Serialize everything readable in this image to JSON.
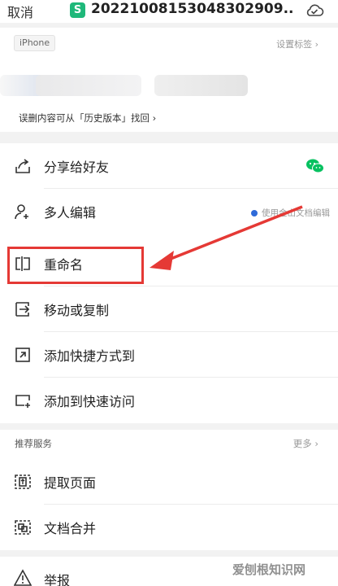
{
  "header": {
    "cancel_label": "取消",
    "file_badge": "S",
    "file_title": "20221008153048302909..."
  },
  "info": {
    "device_tag": "iPhone",
    "set_tag_label": "设置标签",
    "history_link": "误删内容可从「历史版本」找回"
  },
  "menu": {
    "share": "分享给好友",
    "multi_edit": "多人编辑",
    "multi_edit_hint": "使用金山文档编辑",
    "rename": "重命名",
    "move_copy": "移动或复制",
    "add_shortcut": "添加快捷方式到",
    "add_quick_access": "添加到快速访问"
  },
  "services": {
    "title": "推荐服务",
    "more_label": "更多",
    "extract_pages": "提取页面",
    "merge_docs": "文档合并"
  },
  "report": {
    "label": "举报"
  },
  "watermark": "爱刨根知识网",
  "colors": {
    "accent_green": "#1fb87a",
    "highlight_red": "#e53935",
    "wechat_green": "#07c160"
  }
}
